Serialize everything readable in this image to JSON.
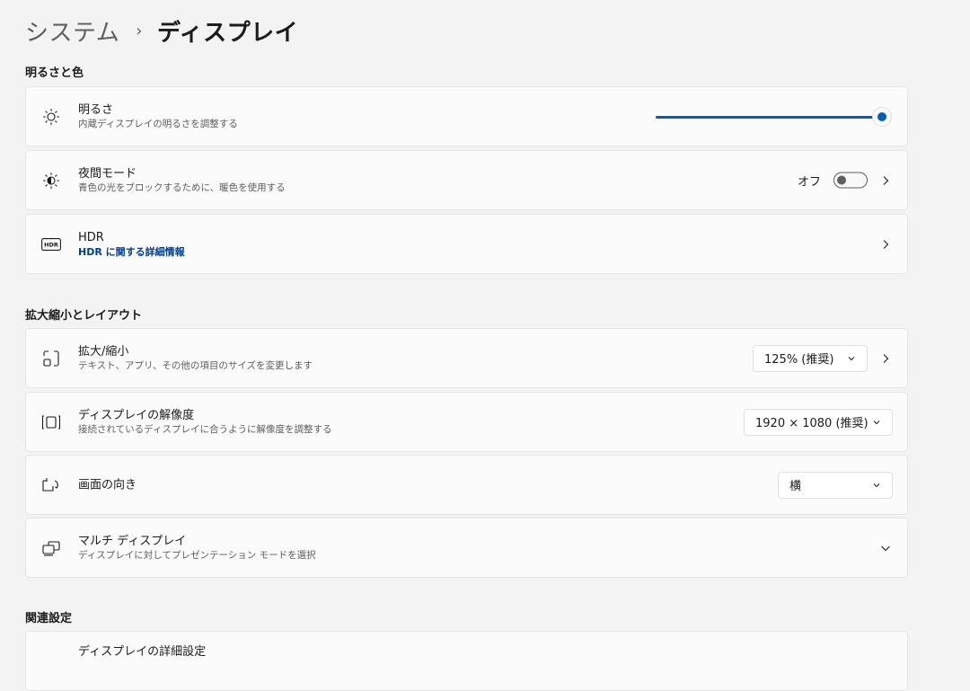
{
  "breadcrumb": {
    "parent": "システム",
    "separator": "›",
    "current": "ディスプレイ"
  },
  "sections": {
    "brightness_color": "明るさと色",
    "scale_layout": "拡大縮小とレイアウト",
    "related": "関連設定"
  },
  "brightness": {
    "title": "明るさ",
    "subtitle": "内蔵ディスプレイの明るさを調整する",
    "value_percent": 100
  },
  "night_light": {
    "title": "夜間モード",
    "subtitle": "青色の光をブロックするために、暖色を使用する",
    "state": "オフ"
  },
  "hdr": {
    "title": "HDR",
    "link": "HDR に関する詳細情報"
  },
  "scale": {
    "title": "拡大/縮小",
    "subtitle": "テキスト、アプリ、その他の項目のサイズを変更します",
    "value": "125% (推奨)"
  },
  "resolution": {
    "title": "ディスプレイの解像度",
    "subtitle": "接続されているディスプレイに合うように解像度を調整する",
    "value": "1920 × 1080 (推奨)"
  },
  "orientation": {
    "title": "画面の向き",
    "value": "横"
  },
  "multi_display": {
    "title": "マルチ ディスプレイ",
    "subtitle": "ディスプレイに対してプレゼンテーション モードを選択"
  },
  "advanced": {
    "title": "ディスプレイの詳細設定"
  },
  "colors": {
    "accent": "#005fb8",
    "link": "#003e92",
    "background": "#f3f3f3",
    "card": "#fbfbfb"
  }
}
